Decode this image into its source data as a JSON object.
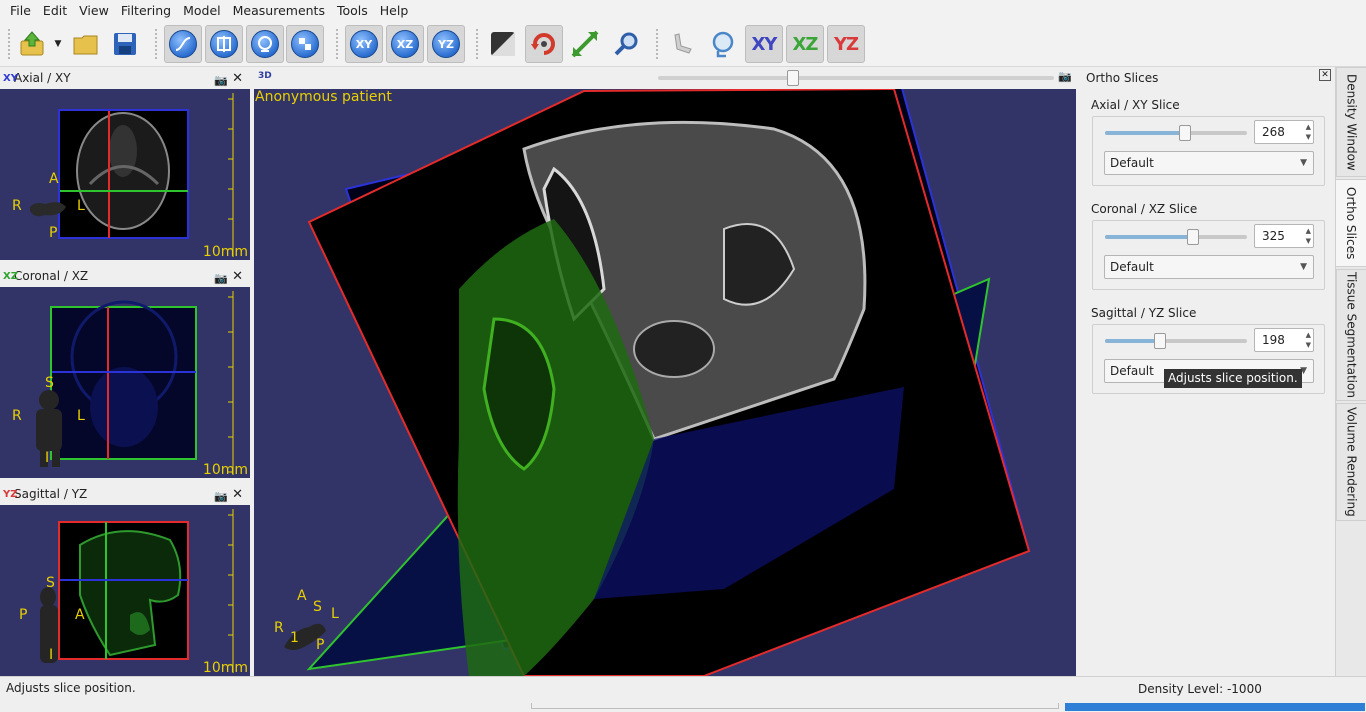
{
  "menu": [
    "File",
    "Edit",
    "View",
    "Filtering",
    "Model",
    "Measurements",
    "Tools",
    "Help"
  ],
  "toolbar": {
    "axis_buttons": [
      "XY",
      "XZ",
      "YZ"
    ],
    "view_buttons": [
      "XY",
      "XZ",
      "YZ"
    ]
  },
  "panels": {
    "axial": {
      "tag": "XY",
      "title": "Axial / XY",
      "scale": "10mm",
      "labels": {
        "top": "A",
        "left": "R",
        "right": "L",
        "bottom": "P"
      }
    },
    "coronal": {
      "tag": "XZ",
      "title": "Coronal / XZ",
      "scale": "10mm",
      "labels": {
        "top": "S",
        "left": "R",
        "right": "L",
        "bottom": "I"
      }
    },
    "sagittal": {
      "tag": "YZ",
      "title": "Sagittal / YZ",
      "scale": "10mm",
      "labels": {
        "top": "S",
        "left": "P",
        "right": "A",
        "bottom": "I"
      }
    }
  },
  "main_view": {
    "tag": "3D",
    "patient": "Anonymous patient",
    "slider_fraction": 0.34,
    "orient": {
      "a": "A",
      "s": "S",
      "l": "L",
      "r": "R",
      "i": "1",
      "p": "P"
    }
  },
  "ortho": {
    "title": "Ortho Slices",
    "groups": [
      {
        "label": "Axial / XY Slice",
        "value": "268",
        "preset": "Default",
        "fraction": 0.56
      },
      {
        "label": "Coronal / XZ Slice",
        "value": "325",
        "preset": "Default",
        "fraction": 0.62
      },
      {
        "label": "Sagittal / YZ Slice",
        "value": "198",
        "preset": "Default",
        "fraction": 0.39
      }
    ]
  },
  "tabs": [
    "Density Window",
    "Ortho Slices",
    "Tissue Segmentation",
    "Volume Rendering"
  ],
  "tooltip": "Adjusts slice position.",
  "status": {
    "message": "Adjusts slice position.",
    "density": "Density Level: -1000"
  }
}
